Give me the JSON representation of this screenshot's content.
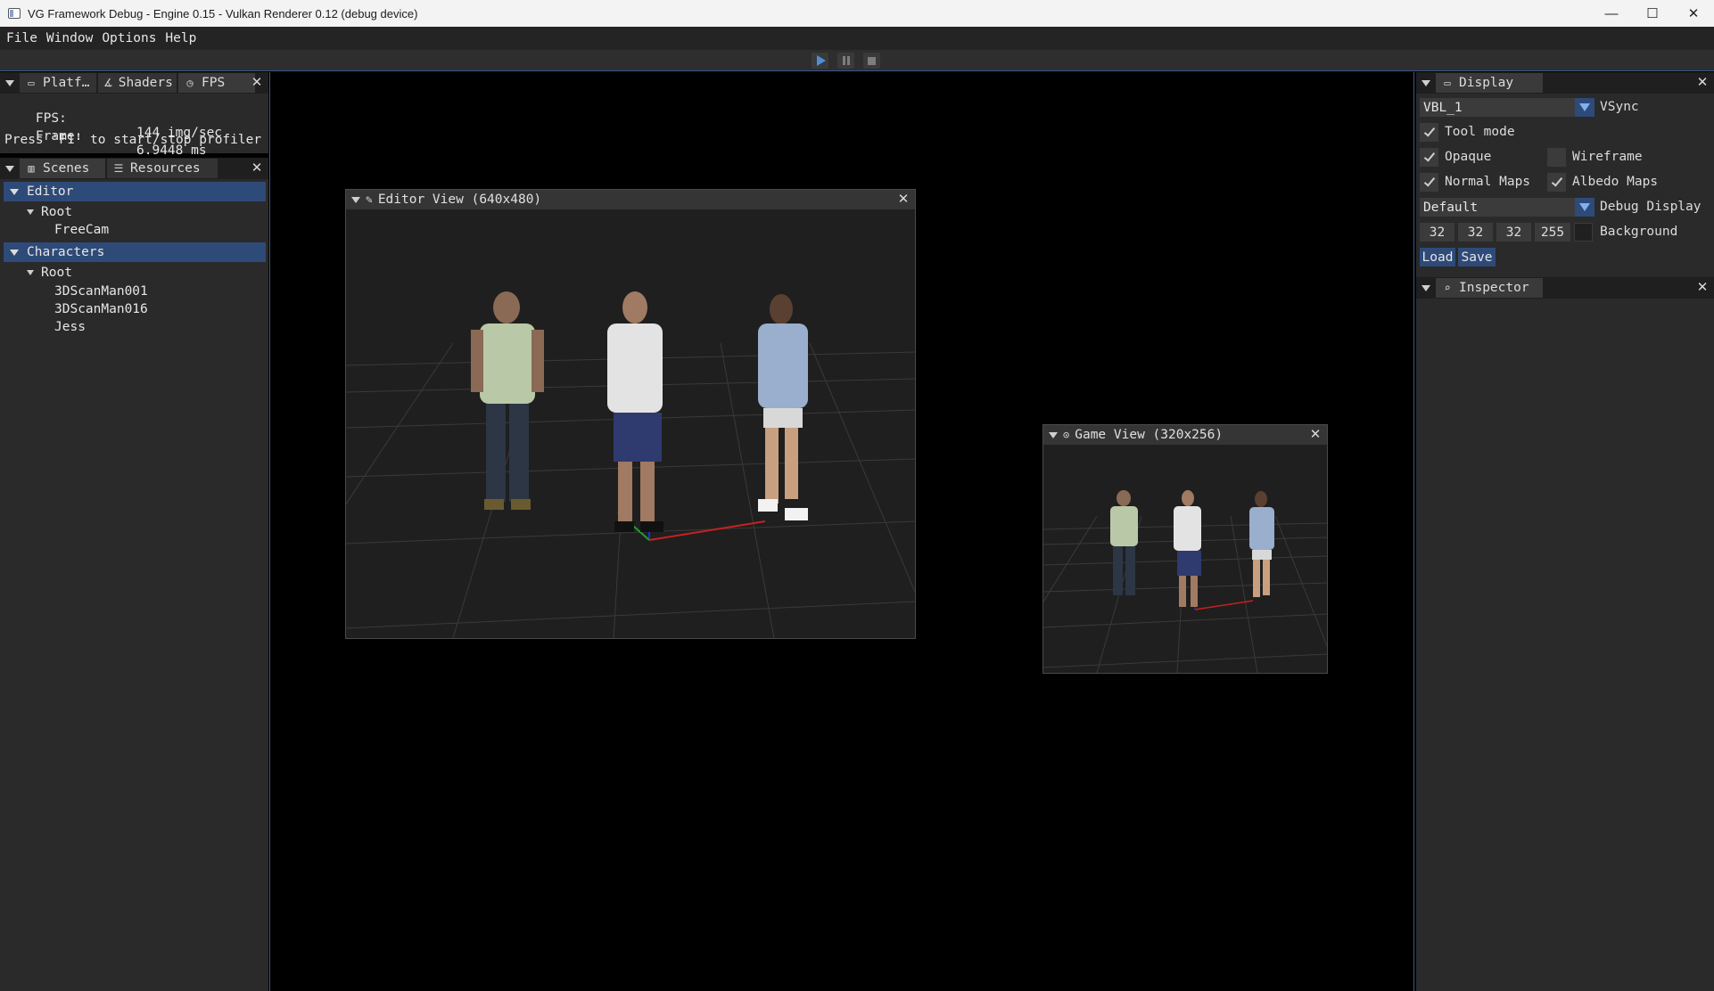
{
  "window": {
    "title": "VG Framework Debug - Engine 0.15 - Vulkan Renderer 0.12 (debug device)",
    "minimize": "—",
    "maximize": "☐",
    "close": "✕"
  },
  "menubar": [
    "File",
    "Window",
    "Options",
    "Help"
  ],
  "toolbar": {
    "play_icon": "play-icon",
    "pause_icon": "pause-icon",
    "stop_icon": "stop-icon",
    "play_color": "#4d8ed8"
  },
  "fps_panel": {
    "tabs": [
      {
        "label": "Platf…",
        "icon": "monitor-icon"
      },
      {
        "label": "Shaders",
        "icon": "compass-icon"
      },
      {
        "label": "FPS",
        "icon": "stopwatch-icon"
      }
    ],
    "rows": [
      {
        "label": "FPS:",
        "value": "144 img/sec"
      },
      {
        "label": "Frame:",
        "value": "6.9448 ms"
      }
    ],
    "hint": "Press 'F1' to start/stop profiler"
  },
  "scenes_panel": {
    "tabs": [
      {
        "label": "Scenes",
        "icon": "map-icon"
      },
      {
        "label": "Resources",
        "icon": "stack-icon"
      }
    ],
    "tree": [
      {
        "label": "Editor",
        "children": [
          {
            "label": "Root",
            "children": [
              "FreeCam"
            ]
          }
        ]
      },
      {
        "label": "Characters",
        "children": [
          {
            "label": "Root",
            "children": [
              "3DScanMan001",
              "3DScanMan016",
              "Jess"
            ]
          }
        ]
      }
    ]
  },
  "editor_view": {
    "title": "Editor View (640x480)"
  },
  "game_view": {
    "title": "Game View (320x256)"
  },
  "display_panel": {
    "tab": "Display",
    "vsync_value": "VBL_1",
    "vsync_label": "VSync",
    "tool_mode": {
      "label": "Tool mode",
      "checked": true
    },
    "opaque": {
      "label": "Opaque",
      "checked": true
    },
    "wireframe": {
      "label": "Wireframe",
      "checked": false
    },
    "normal_maps": {
      "label": "Normal Maps",
      "checked": true
    },
    "albedo_maps": {
      "label": "Albedo Maps",
      "checked": true
    },
    "debug_display_value": "Default",
    "debug_display_label": "Debug Display",
    "background": {
      "r": "32",
      "g": "32",
      "b": "32",
      "a": "255",
      "label": "Background",
      "color": "#202020"
    },
    "load": "Load",
    "save": "Save"
  },
  "inspector_panel": {
    "tab": "Inspector"
  },
  "colors": {
    "accent": "#2e4a78",
    "panel": "#2a2a2a",
    "selected_row": "#2e4a78"
  }
}
